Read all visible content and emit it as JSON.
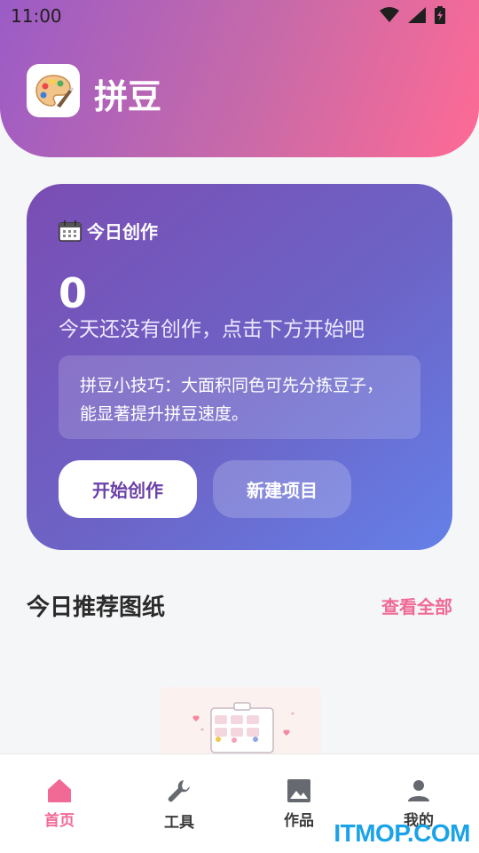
{
  "status_bar": {
    "time": "11:00"
  },
  "app": {
    "title": "拼豆"
  },
  "today_card": {
    "title": "今日创作",
    "count": "0",
    "subtitle": "今天还没有创作，点击下方开始吧",
    "tip_line1": "拼豆小技巧：大面积同色可先分拣豆子，",
    "tip_line2": "能显著提升拼豆速度。",
    "start_label": "开始创作",
    "new_label": "新建项目"
  },
  "recommend": {
    "title": "今日推荐图纸",
    "view_all": "查看全部"
  },
  "bottom_nav": [
    {
      "label": "首页",
      "icon": "home-icon",
      "active": true
    },
    {
      "label": "工具",
      "icon": "wrench-icon",
      "active": false
    },
    {
      "label": "作品",
      "icon": "image-icon",
      "active": false
    },
    {
      "label": "我的",
      "icon": "person-icon",
      "active": false
    }
  ],
  "watermark": "ITMOP.COM",
  "colors": {
    "accent": "#f06a95",
    "card_start": "#7a4db3",
    "card_end": "#6480e8"
  }
}
